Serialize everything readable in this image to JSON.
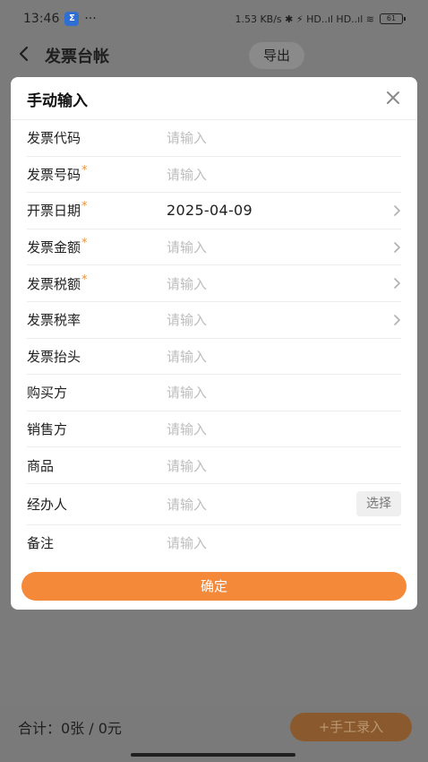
{
  "status": {
    "time": "13:46",
    "more": "···",
    "indicators": "1.53 KB/s ✱ ⚡ HD..ıl HD..ıl ≋",
    "battery": "61"
  },
  "nav": {
    "title": "发票台帐",
    "export_label": "导出"
  },
  "modal": {
    "title": "手动输入",
    "close_icon": "close-icon",
    "fields": [
      {
        "label": "发票代码",
        "required": false,
        "value": "",
        "placeholder": "请输入",
        "chevron": false,
        "select": false
      },
      {
        "label": "发票号码",
        "required": true,
        "value": "",
        "placeholder": "请输入",
        "chevron": false,
        "select": false
      },
      {
        "label": "开票日期",
        "required": true,
        "value": "2025-04-09",
        "placeholder": "",
        "chevron": true,
        "select": false
      },
      {
        "label": "发票金额",
        "required": true,
        "value": "",
        "placeholder": "请输入",
        "chevron": true,
        "select": false
      },
      {
        "label": "发票税额",
        "required": true,
        "value": "",
        "placeholder": "请输入",
        "chevron": true,
        "select": false
      },
      {
        "label": "发票税率",
        "required": false,
        "value": "",
        "placeholder": "请输入",
        "chevron": true,
        "select": false
      },
      {
        "label": "发票抬头",
        "required": false,
        "value": "",
        "placeholder": "请输入",
        "chevron": false,
        "select": false
      },
      {
        "label": "购买方",
        "required": false,
        "value": "",
        "placeholder": "请输入",
        "chevron": false,
        "select": false
      },
      {
        "label": "销售方",
        "required": false,
        "value": "",
        "placeholder": "请输入",
        "chevron": false,
        "select": false
      },
      {
        "label": "商品",
        "required": false,
        "value": "",
        "placeholder": "请输入",
        "chevron": false,
        "select": false
      },
      {
        "label": "经办人",
        "required": false,
        "value": "",
        "placeholder": "请输入",
        "chevron": false,
        "select": true
      },
      {
        "label": "备注",
        "required": false,
        "value": "",
        "placeholder": "请输入",
        "chevron": false,
        "select": false
      }
    ],
    "required_mark": "*",
    "select_label": "选择",
    "confirm_label": "确定"
  },
  "footer": {
    "total_text": "合计：0张 / 0元",
    "manual_entry_label": "+手工录入"
  },
  "colors": {
    "accent": "#f5893a",
    "required": "#e8923c",
    "overlay": "#7b7b7b"
  }
}
